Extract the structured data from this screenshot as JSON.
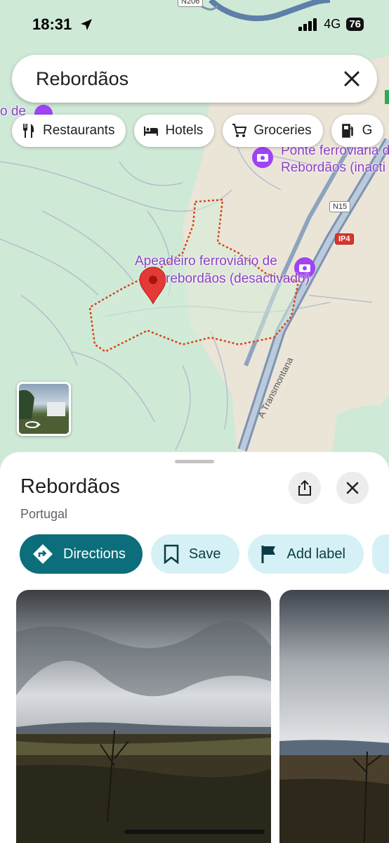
{
  "status_bar": {
    "time": "18:31",
    "network": "4G",
    "battery": "76"
  },
  "search": {
    "query": "Rebordãos"
  },
  "chips": [
    {
      "icon": "restaurant-icon",
      "label": "Restaurants"
    },
    {
      "icon": "hotel-icon",
      "label": "Hotels"
    },
    {
      "icon": "cart-icon",
      "label": "Groceries"
    },
    {
      "icon": "gas-icon",
      "label": "G"
    }
  ],
  "map": {
    "labels": {
      "ponte_line1": "Ponte ferroviária d",
      "ponte_line2": "Rebordãos (inacti",
      "apeadeiro_line1": "Apeadeiro ferroviário de",
      "apeadeiro_line2": "rebordãos (desactivado)",
      "left_partial": "o de"
    },
    "road_shields": {
      "n206": "N206",
      "n15": "N15",
      "ip4": "IP4"
    },
    "road_name": "A Transmontana"
  },
  "place": {
    "title": "Rebordãos",
    "subtitle": "Portugal"
  },
  "actions": {
    "directions": "Directions",
    "save": "Save",
    "add_label": "Add label"
  },
  "colors": {
    "accent": "#0b6e7a",
    "chip_bg": "#d5f1f6",
    "pin": "#e53935",
    "poi": "#8a3fc4",
    "boundary": "#d84315"
  }
}
